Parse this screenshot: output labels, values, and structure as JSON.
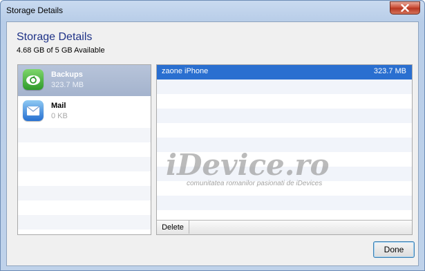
{
  "window": {
    "title": "Storage Details"
  },
  "dialog": {
    "heading": "Storage Details",
    "subheading": "4.68 GB of 5 GB Available"
  },
  "sidebar": {
    "items": [
      {
        "name": "Backups",
        "size": "323.7 MB",
        "icon": "backup-icon",
        "selected": true
      },
      {
        "name": "Mail",
        "size": "0 KB",
        "icon": "mail-icon",
        "selected": false
      }
    ]
  },
  "backups_list": {
    "rows": [
      {
        "name": "zaone iPhone",
        "size": "323.7 MB",
        "selected": true
      }
    ],
    "delete_label": "Delete"
  },
  "watermark": {
    "main": "iDevice.ro",
    "sub": "comunitatea romanilor pasionati de iDevices"
  },
  "footer": {
    "done_label": "Done"
  },
  "colors": {
    "selection": "#2a6fd0",
    "heading": "#1e3287"
  }
}
